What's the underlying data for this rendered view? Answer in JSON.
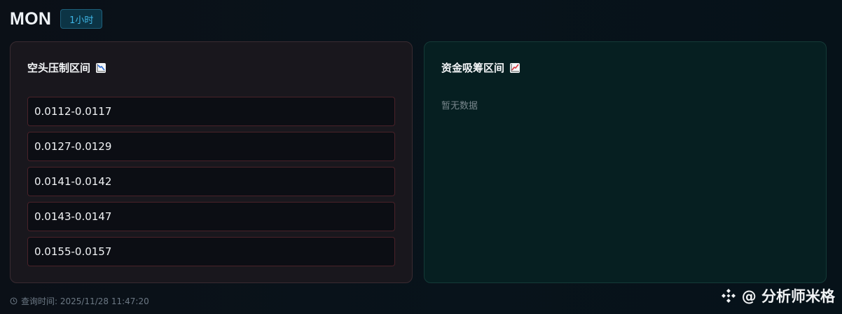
{
  "header": {
    "symbol": "MON",
    "timeframe": "1小时"
  },
  "short_zone": {
    "title": "空头压制区间",
    "icon": "chart-decreasing-icon",
    "ranges": [
      "0.0112-0.0117",
      "0.0127-0.0129",
      "0.0141-0.0142",
      "0.0143-0.0147",
      "0.0155-0.0157"
    ]
  },
  "accumulation_zone": {
    "title": "资金吸筹区间",
    "icon": "chart-increasing-icon",
    "empty_text": "暂无数据"
  },
  "footer": {
    "query_time": "查询时间: 2025/11/28 11:47:20"
  },
  "watermark": {
    "text": "@ 分析师米格"
  },
  "colors": {
    "background": "#08111a",
    "short_card_bg": "#19171d",
    "short_card_border": "#3a2b31",
    "range_border": "#4a2229",
    "accum_card_bg": "#061f21",
    "badge_text": "#3fb6e6",
    "badge_bg": "#0c3445"
  }
}
